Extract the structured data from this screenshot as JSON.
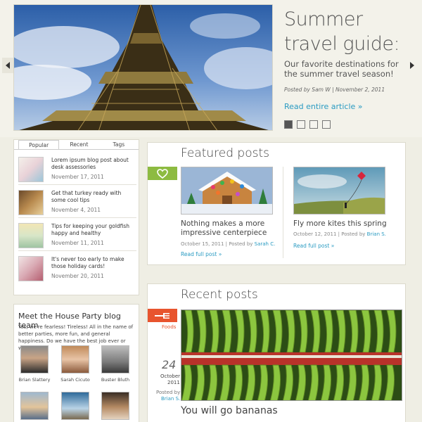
{
  "hero": {
    "title": "Summer travel guide:",
    "subtitle": "Our favorite  destinations for the summer travel season!",
    "meta": "Posted by Sam W | November 2, 2011",
    "link": "Read entire article »",
    "dots_active": 0,
    "dots_count": 4
  },
  "sidebar_tabs": {
    "tabs": [
      "Popular",
      "Recent",
      "Tags"
    ],
    "active_tab": "Popular",
    "items": [
      {
        "title": "Lorem ipsum blog post about desk assessories",
        "date": "November 17, 2011"
      },
      {
        "title": "Get that turkey ready with some cool tips",
        "date": "November 4, 2011"
      },
      {
        "title": "Tips for keeping your goldfish happy and healthy",
        "date": "November 11, 2011"
      },
      {
        "title": "It's never too early to make those holiday cards!",
        "date": "November 20, 2011"
      }
    ]
  },
  "team": {
    "title": "Meet the House Party blog team",
    "text": "Yes, we're fearless! Tireless! All in the name of better parties, more fun, and general happiness. Do we have the best job ever or what?!?",
    "members": [
      "Brian Slattery",
      "Sarah Cicuto",
      "Buster Bluth"
    ]
  },
  "featured": {
    "title": "Featured posts",
    "posts": [
      {
        "title": "Nothing makes a more impressive centerpiece",
        "date": "October 15, 2011 | Posted by ",
        "author": "Sarah C.",
        "link": "Read full post »"
      },
      {
        "title": "Fly more kites this spring",
        "date": "October 12, 2011 | Posted by ",
        "author": "Brian S.",
        "link": "Read full post »"
      }
    ]
  },
  "recent": {
    "title": "Recent posts",
    "category": "Foods",
    "day": "24",
    "month": "October",
    "year": "2011",
    "posted_by": "Posted by",
    "author": "Brian S.",
    "post_title": "You will go bananas"
  },
  "colors": {
    "accent_blue": "#2a9bc2",
    "featured_tag": "#8dbb41",
    "recent_tag": "#e8542e"
  }
}
